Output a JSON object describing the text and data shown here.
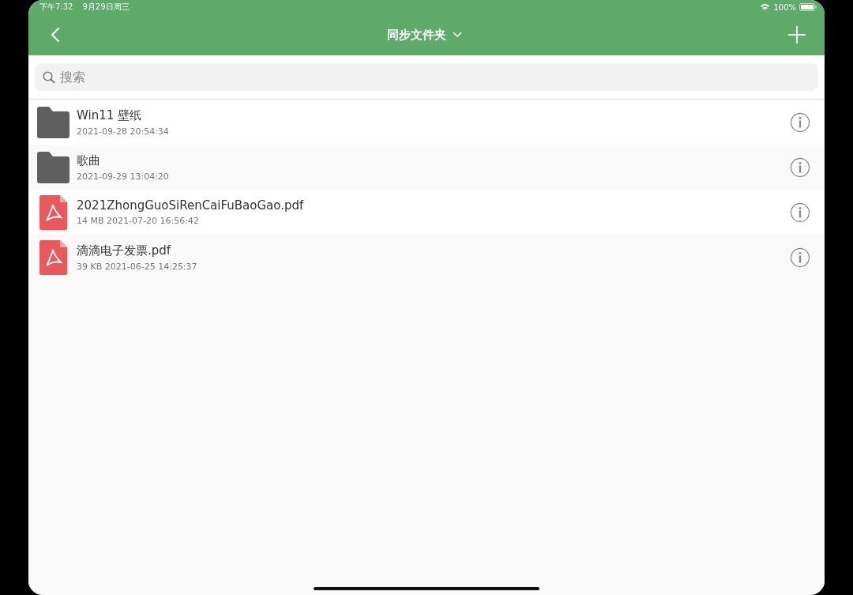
{
  "status_bar": {
    "time": "下午7:32",
    "date": "9月29日周三",
    "battery": "100%"
  },
  "nav_bar": {
    "title": "同步文件夹"
  },
  "search": {
    "placeholder": "搜索"
  },
  "files": [
    {
      "kind": "folder",
      "name": "Win11 壁纸",
      "meta": "2021-09-28 20:54:34"
    },
    {
      "kind": "folder",
      "name": "歌曲",
      "meta": "2021-09-29 13:04:20"
    },
    {
      "kind": "pdf",
      "name": "2021ZhongGuoSiRenCaiFuBaoGao.pdf",
      "meta": "14 MB 2021-07-20 16:56:42"
    },
    {
      "kind": "pdf",
      "name": "滴滴电子发票.pdf",
      "meta": "39 KB 2021-06-25 14:25:37"
    }
  ]
}
